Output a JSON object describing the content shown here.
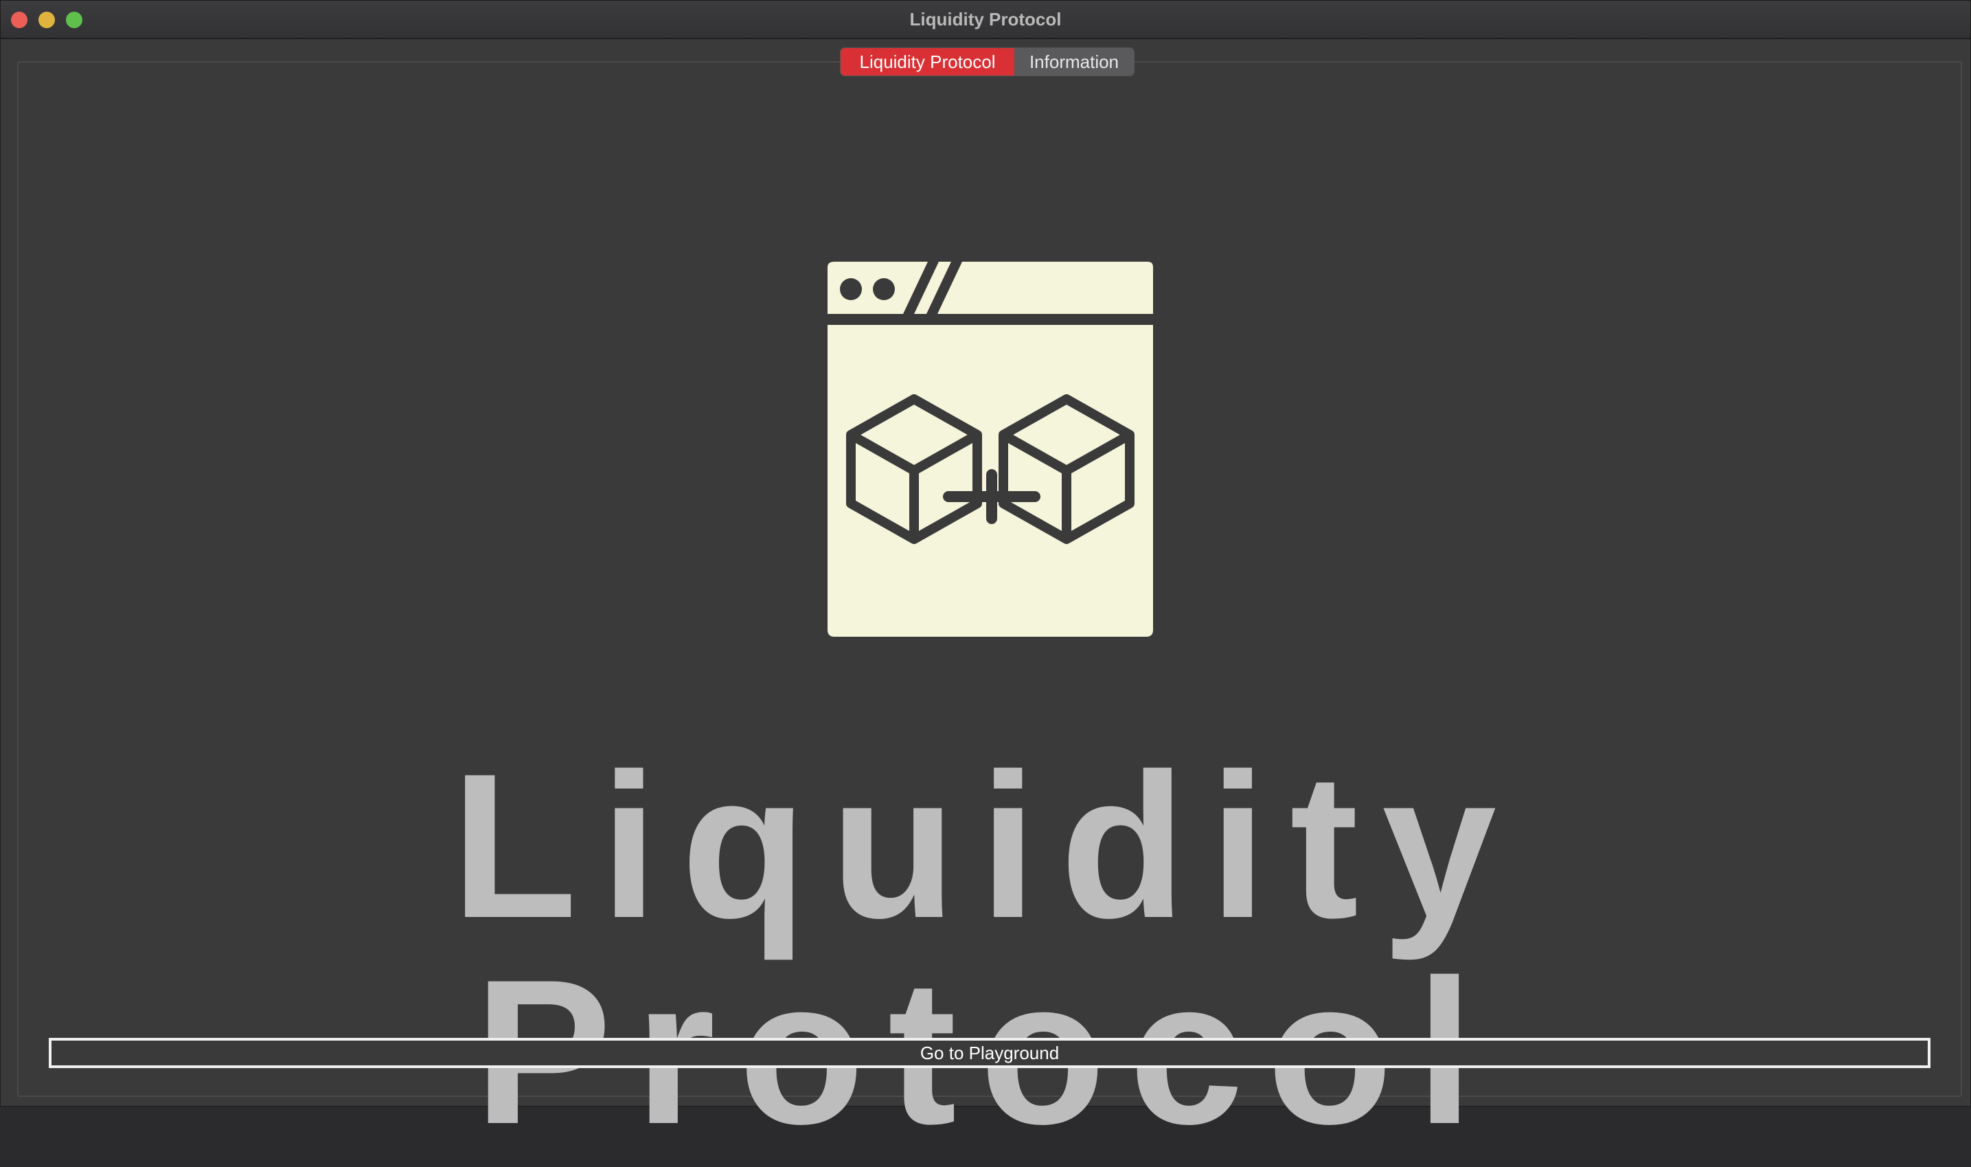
{
  "window": {
    "title": "Liquidity Protocol"
  },
  "tabs": [
    {
      "label": "Liquidity Protocol",
      "active": true
    },
    {
      "label": "Information",
      "active": false
    }
  ],
  "logo": {
    "icon": "browser-window-linked-blocks-icon",
    "background_color": "#f5f5dc",
    "stroke_color": "#3a3a3a"
  },
  "hero": {
    "wordmark": "Liquidity Protocol"
  },
  "actions": {
    "playground_label": "Go to Playground"
  },
  "colors": {
    "accent": "#d93035",
    "background": "#3a3a3a",
    "wordmark": "#bdbdbd"
  }
}
